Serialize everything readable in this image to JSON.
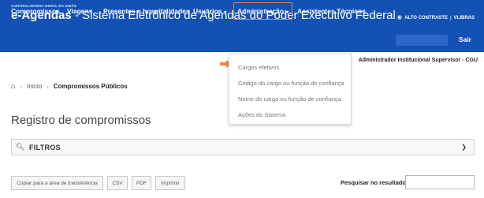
{
  "header": {
    "org": "CONTROLADORIA-GERAL DA UNIÃO",
    "brand": "e-Agendas",
    "title": " - Sistema Eletrônico de Agendas do Poder Executivo Federal",
    "contrast_label": "ALTO CONTRASTE",
    "libras_label": "VLIBRAS",
    "contrast_icon": "sun-icon"
  },
  "nav": {
    "items": [
      {
        "label": "Compromissos"
      },
      {
        "label": "Viagens"
      },
      {
        "label": "Presentes e hospitalidades"
      },
      {
        "label": "Usuários",
        "caret": "▾"
      },
      {
        "label": "Administração",
        "caret": "▾"
      },
      {
        "label": "Assistentes Técnicos"
      }
    ],
    "logout_label": "Sair",
    "accent_color": "#1351b4",
    "active_border_color": "#f0862f"
  },
  "role": "Administrador Institucional Supervisor - CGU",
  "dropdown": {
    "items": [
      {
        "label": "Cargos efetivos"
      },
      {
        "label": "Código do cargo ou função de confiança"
      },
      {
        "label": "Nome do cargo ou função de confiança"
      },
      {
        "label": "Ações do Sistema"
      }
    ]
  },
  "breadcrumb": {
    "home": "Início",
    "current": "Compromissos Públicos"
  },
  "page_title": "Registro de compromissos",
  "filters": {
    "label": "FILTROS"
  },
  "toolbar": {
    "copy_label": "Copiar para a área de transferência",
    "csv_label": "CSV",
    "pdf_label": "PDF",
    "print_label": "Imprimir",
    "search_label": "Pesquisar no resultado",
    "search_value": ""
  }
}
